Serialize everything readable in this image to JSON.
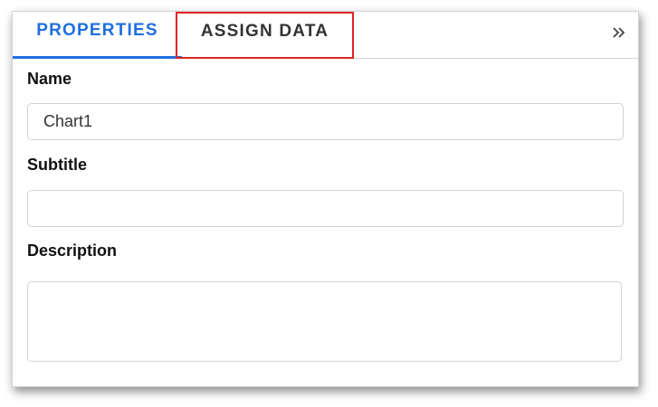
{
  "tabs": {
    "properties_label": "PROPERTIES",
    "assign_data_label": "ASSIGN DATA",
    "active": "PROPERTIES"
  },
  "icons": {
    "expand": "double-chevron-right-icon"
  },
  "colors": {
    "active_tab": "#1f6fe0",
    "highlight_box": "#e02424"
  },
  "fields": {
    "name_label": "Name",
    "name_value": "Chart1",
    "subtitle_label": "Subtitle",
    "subtitle_value": "",
    "description_label": "Description",
    "description_value": ""
  }
}
